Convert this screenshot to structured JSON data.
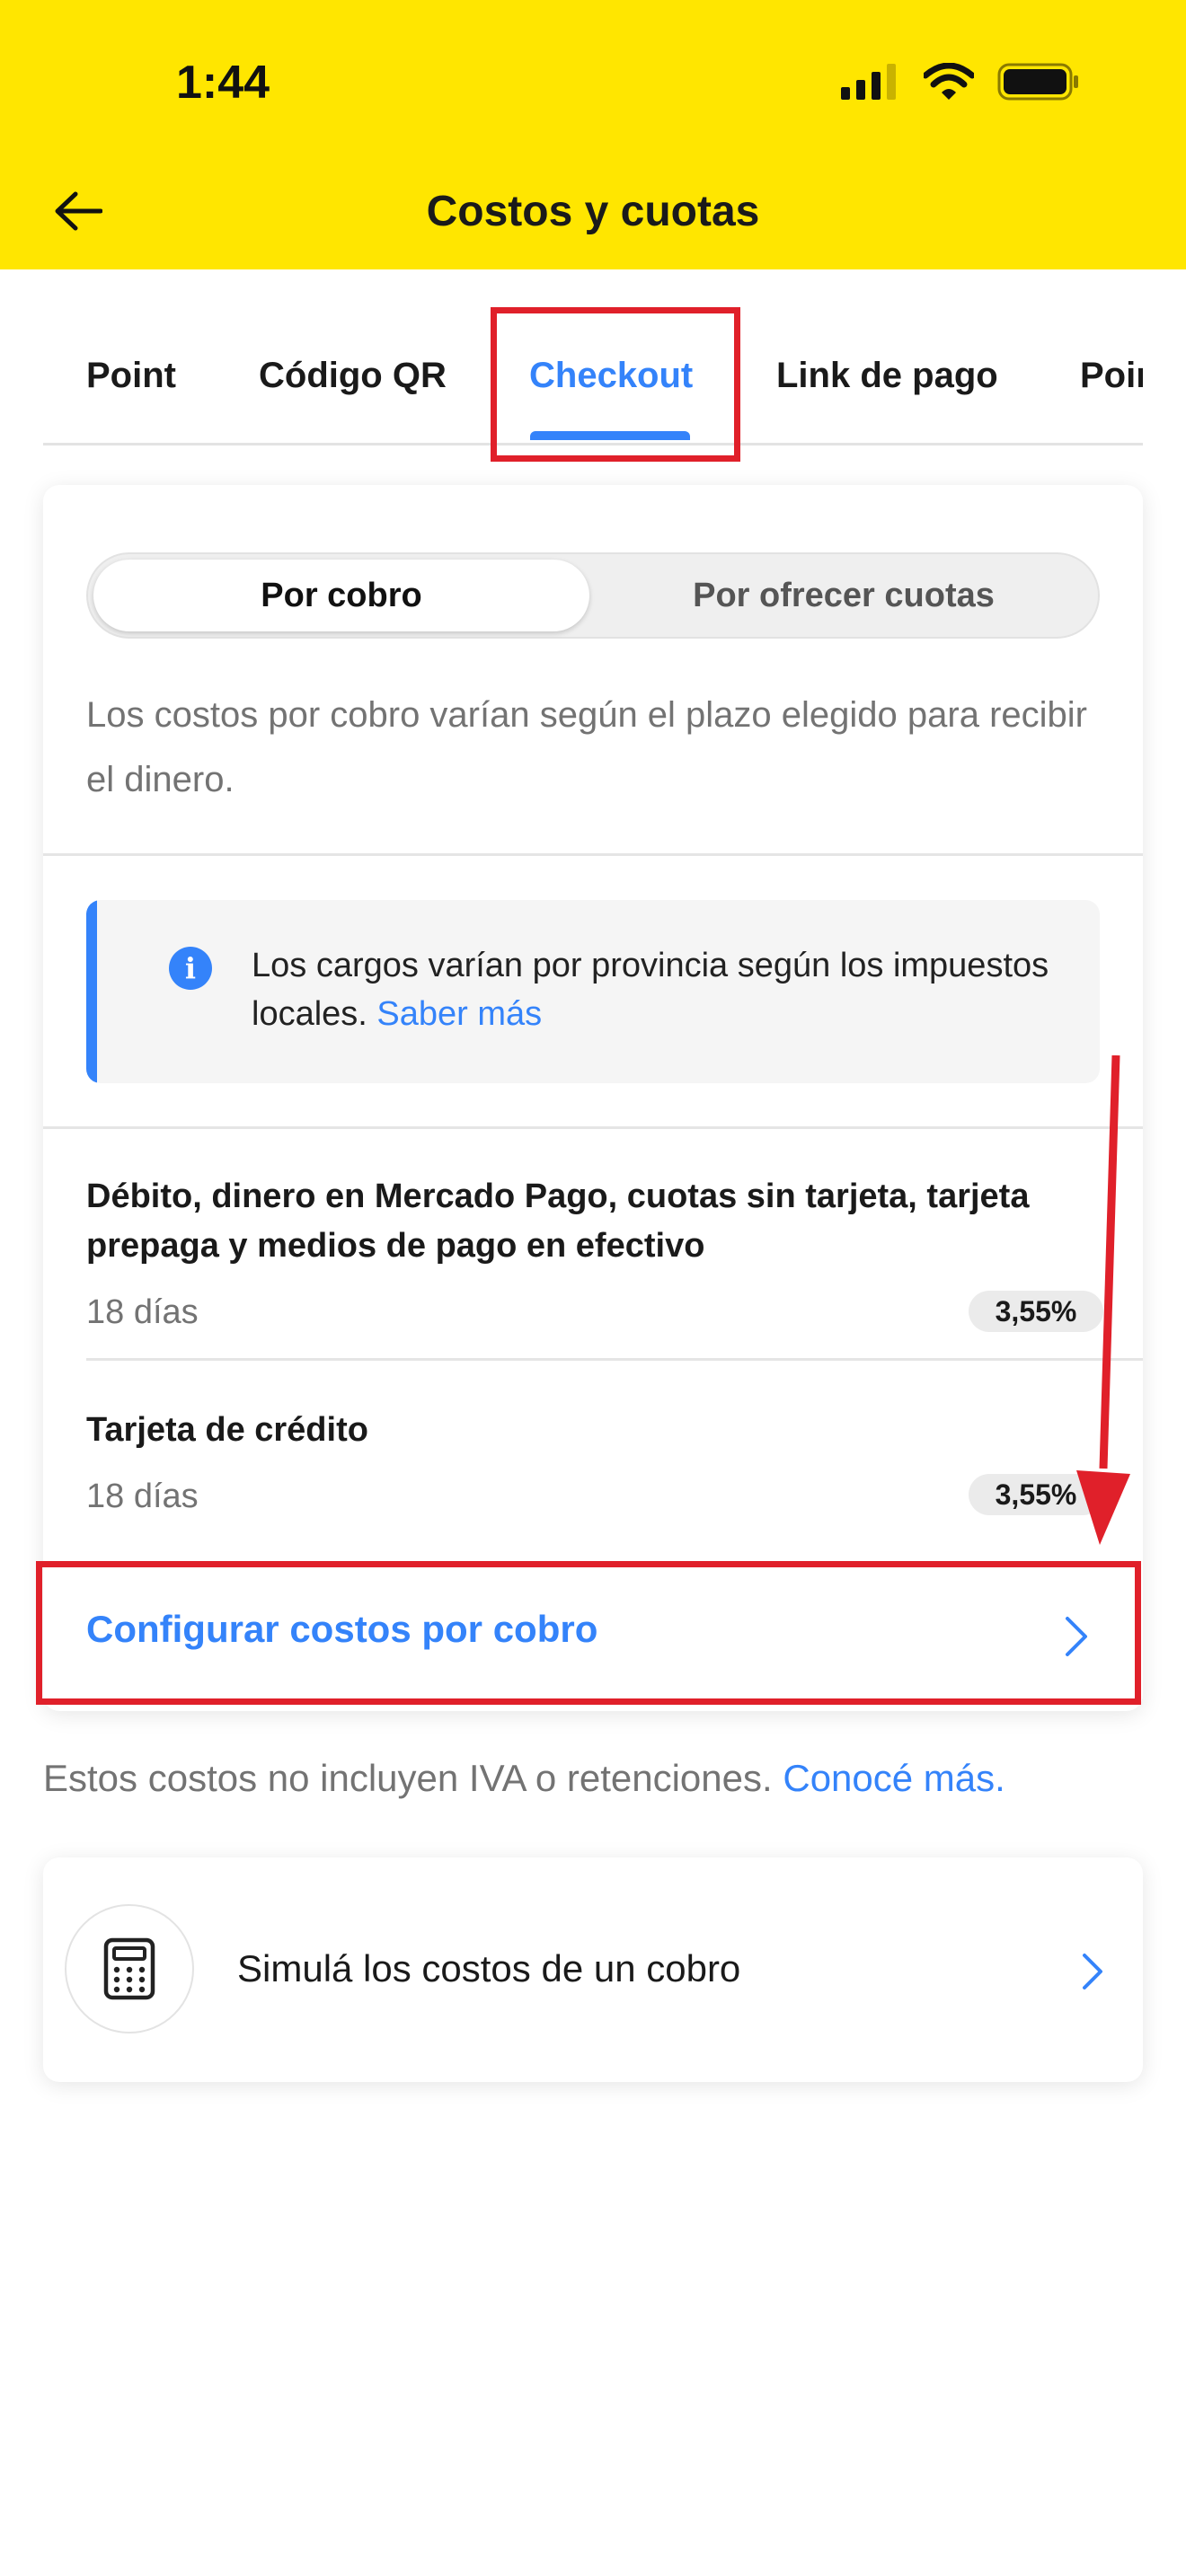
{
  "status_bar": {
    "time": "1:44"
  },
  "header": {
    "title": "Costos y cuotas"
  },
  "tabs": [
    {
      "label": "Point"
    },
    {
      "label": "Código QR"
    },
    {
      "label": "Checkout"
    },
    {
      "label": "Link de pago"
    },
    {
      "label": "Point"
    }
  ],
  "card": {
    "segments": [
      {
        "label": "Por cobro"
      },
      {
        "label": "Por ofrecer cuotas"
      }
    ],
    "description": "Los costos por cobro varían según el plazo elegido para recibir el dinero.",
    "info": {
      "text": "Los cargos varían por provincia según los impuestos locales.",
      "link": "Saber más"
    },
    "rows": [
      {
        "title": "Débito, dinero en Mercado Pago, cuotas sin tarjeta, tarjeta prepaga y medios de pago en efectivo",
        "term": "18 días",
        "rate": "3,55%"
      },
      {
        "title": "Tarjeta de crédito",
        "term": "18 días",
        "rate": "3,55%"
      }
    ],
    "configure_label": "Configurar costos por cobro"
  },
  "footnote": {
    "text": "Estos costos no incluyen IVA o retenciones.",
    "link": "Conocé más."
  },
  "simulator": {
    "label": "Simulá los costos de un cobro"
  },
  "colors": {
    "brand_yellow": "#ffe600",
    "accent_blue": "#3483fa",
    "highlight_red": "#e0202a"
  }
}
